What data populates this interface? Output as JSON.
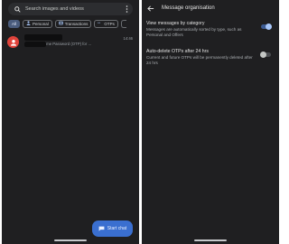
{
  "left": {
    "search": {
      "placeholder": "Search images and videos"
    },
    "chips": [
      {
        "label": "All",
        "icon": "",
        "active": true
      },
      {
        "label": "Personal",
        "icon": "person-icon"
      },
      {
        "label": "Transactions",
        "icon": "receipt-icon"
      },
      {
        "label": "OTPs",
        "icon": "otp-icon"
      }
    ],
    "conversation": {
      "snippet": "is the One Time Password (OTP) for ...",
      "time": "14:46"
    },
    "fab_label": "Start chat"
  },
  "right": {
    "title": "Message organisation",
    "settings": [
      {
        "title": "View messages by category",
        "description": "Messages are automatically sorted by type, such as Personal and Offers",
        "enabled": true
      },
      {
        "title": "Auto-delete OTPs after 24 hrs",
        "description": "Current and future OTPs will be permanently deleted after 24 hrs",
        "enabled": false
      }
    ]
  },
  "colors": {
    "background": "#1f1f21",
    "accent": "#3a6fd0",
    "avatar": "#e0433b",
    "toggle_on": "#a8c7fa"
  }
}
